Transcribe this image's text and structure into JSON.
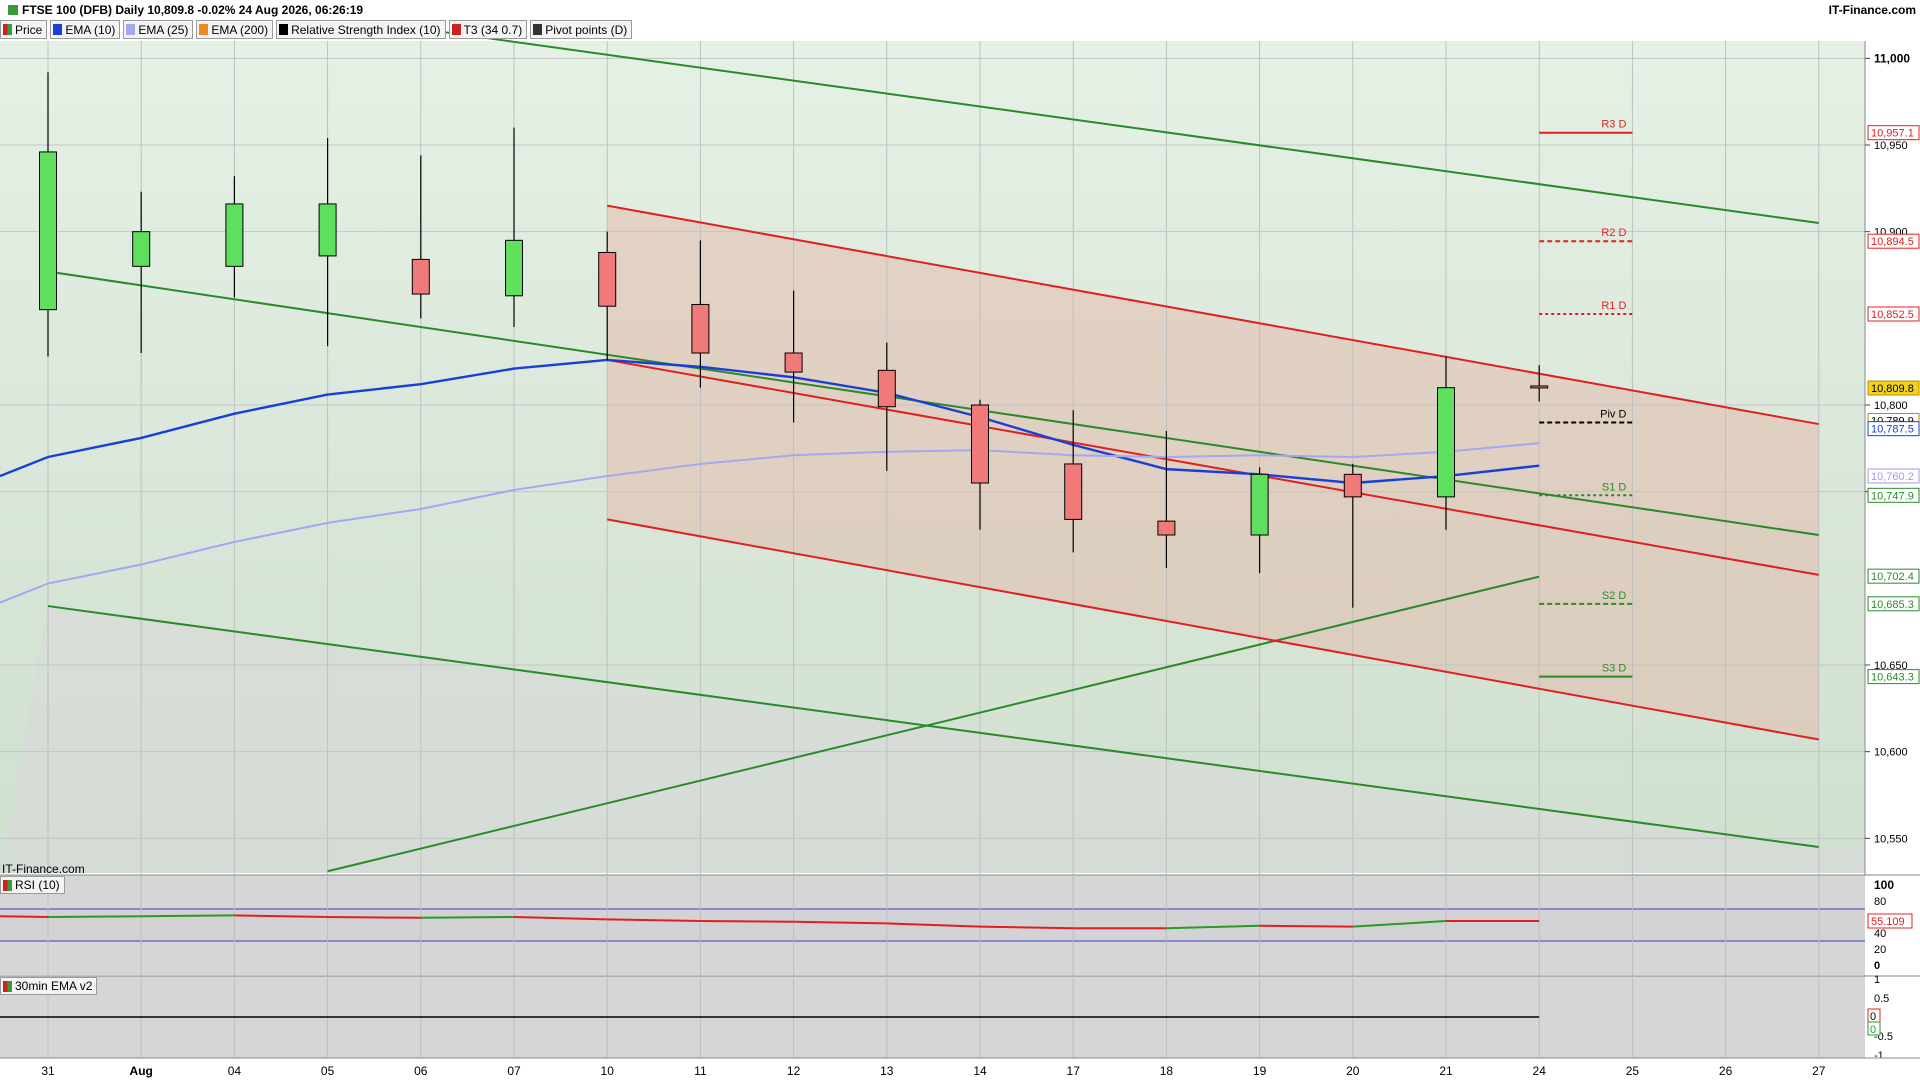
{
  "header": {
    "title": "FTSE 100 (DFB) Daily 10,809.8 -0.02% 24 Aug 2026, 06:26:19",
    "brand": "IT-Finance.com"
  },
  "legend": [
    {
      "label": "Price",
      "color": "#3a9a3a",
      "icon": "price-icon"
    },
    {
      "label": "EMA (10)",
      "color": "#1a3fd6",
      "icon": "swatch"
    },
    {
      "label": "EMA (25)",
      "color": "#a6a6f2",
      "icon": "swatch"
    },
    {
      "label": "EMA (200)",
      "color": "#f08a20",
      "icon": "swatch"
    },
    {
      "label": "Relative Strength Index (10)",
      "color": "#000000",
      "icon": "swatch"
    },
    {
      "label": "T3 (34 0.7)",
      "color": "#cc2222",
      "icon": "swatch"
    },
    {
      "label": "Pivot points (D)",
      "color": "#333333",
      "icon": "swatch"
    }
  ],
  "watermark": "IT-Finance.com",
  "rsi_pane": {
    "label": "RSI (10)",
    "value_label": "55.109",
    "levels": [
      "100",
      "80",
      "60",
      "40",
      "20",
      "0"
    ]
  },
  "ema_pane": {
    "label": "30min EMA v2",
    "levels": [
      "1",
      "0.5",
      "0",
      "-0.5",
      "-1"
    ],
    "value_labels": [
      "0",
      "0"
    ]
  },
  "chart_data": {
    "type": "candlestick",
    "x_labels": [
      "31",
      "Aug",
      "04",
      "05",
      "06",
      "07",
      "10",
      "11",
      "12",
      "13",
      "14",
      "17",
      "18",
      "19",
      "20",
      "21",
      "24",
      "25",
      "26",
      "27"
    ],
    "ylim": [
      10530,
      11010
    ],
    "y_ticks": [
      "11,000",
      "10,950",
      "10,900",
      "10,800",
      "10,750",
      "10,650",
      "10,600",
      "10,550"
    ],
    "candles": [
      {
        "date": "31",
        "open": 10855,
        "high": 10992,
        "low": 10828,
        "close": 10946
      },
      {
        "date": "Aug",
        "open": 10880,
        "high": 10923,
        "low": 10830,
        "close": 10900
      },
      {
        "date": "04",
        "open": 10880,
        "high": 10932,
        "low": 10862,
        "close": 10916
      },
      {
        "date": "05",
        "open": 10886,
        "high": 10954,
        "low": 10834,
        "close": 10916
      },
      {
        "date": "06",
        "open": 10884,
        "high": 10944,
        "low": 10850,
        "close": 10864
      },
      {
        "date": "07",
        "open": 10863,
        "high": 10960,
        "low": 10845,
        "close": 10895
      },
      {
        "date": "10",
        "open": 10888,
        "high": 10900,
        "low": 10826,
        "close": 10857
      },
      {
        "date": "11",
        "open": 10858,
        "high": 10895,
        "low": 10810,
        "close": 10830
      },
      {
        "date": "12",
        "open": 10830,
        "high": 10866,
        "low": 10790,
        "close": 10819
      },
      {
        "date": "13",
        "open": 10820,
        "high": 10836,
        "low": 10762,
        "close": 10799
      },
      {
        "date": "14",
        "open": 10800,
        "high": 10803,
        "low": 10728,
        "close": 10755
      },
      {
        "date": "17",
        "open": 10766,
        "high": 10797,
        "low": 10715,
        "close": 10734
      },
      {
        "date": "18",
        "open": 10733,
        "high": 10785,
        "low": 10706,
        "close": 10725
      },
      {
        "date": "19",
        "open": 10725,
        "high": 10764,
        "low": 10703,
        "close": 10760
      },
      {
        "date": "20",
        "open": 10760,
        "high": 10766,
        "low": 10683,
        "close": 10747
      },
      {
        "date": "21",
        "open": 10747,
        "high": 10828,
        "low": 10728,
        "close": 10810
      },
      {
        "date": "24",
        "open": 10811,
        "high": 10823,
        "low": 10802,
        "close": 10810
      }
    ],
    "series": [
      {
        "name": "EMA (10)",
        "color": "#1a3fd6",
        "values": [
          10770,
          10781,
          10795,
          10806,
          10812,
          10821,
          10826,
          10822,
          10816,
          10807,
          10793,
          10777,
          10763,
          10760,
          10755,
          10759,
          10765
        ]
      },
      {
        "name": "EMA (25)",
        "color": "#a6a6f2",
        "values": [
          10697,
          10708,
          10721,
          10732,
          10740,
          10751,
          10759,
          10766,
          10771,
          10773,
          10774,
          10771,
          10770,
          10771,
          10770,
          10773,
          10778
        ]
      }
    ],
    "trendlines": [
      {
        "color": "#2a8a2a",
        "from": [
          "31",
          10877
        ],
        "to": [
          "27",
          10725
        ]
      },
      {
        "color": "#2a8a2a",
        "from": [
          "06",
          11017
        ],
        "to": [
          "27",
          10905
        ]
      },
      {
        "color": "#2a8a2a",
        "from": [
          "31",
          10684
        ],
        "to": [
          "27",
          10545
        ]
      },
      {
        "color": "#2a8a2a",
        "from": [
          "05",
          10531
        ],
        "to": [
          "24",
          10701
        ]
      },
      {
        "color": "#e02020",
        "from": [
          "10",
          10915
        ],
        "to": [
          "27",
          10789
        ]
      },
      {
        "color": "#e02020",
        "from": [
          "10",
          10826
        ],
        "to": [
          "27",
          10702
        ]
      },
      {
        "color": "#e02020",
        "from": [
          "10",
          10734
        ],
        "to": [
          "27",
          10607
        ]
      }
    ],
    "pivots": [
      {
        "label": "R3 D",
        "value": 10957.1,
        "value_label": "10,957.1",
        "color": "#e02020",
        "style": "solid"
      },
      {
        "label": "R2 D",
        "value": 10894.5,
        "value_label": "10,894.5",
        "color": "#e02020",
        "style": "dashed"
      },
      {
        "label": "R1 D",
        "value": 10852.5,
        "value_label": "10,852.5",
        "color": "#e02020",
        "style": "dotted"
      },
      {
        "label": "Piv D",
        "value": 10789.9,
        "value_label": "10,789.9",
        "color": "#000000",
        "style": "dashed"
      },
      {
        "label": "S1 D",
        "value": 10747.9,
        "value_label": "10,747.9",
        "color": "#2a8a2a",
        "style": "dotted"
      },
      {
        "label": "S2 D",
        "value": 10685.3,
        "value_label": "10,685.3",
        "color": "#2a8a2a",
        "style": "dashed"
      },
      {
        "label": "S3 D",
        "value": 10643.3,
        "value_label": "10,643.3",
        "color": "#2a8a2a",
        "style": "solid"
      }
    ],
    "price_labels": [
      {
        "value": 10809.8,
        "text": "10,809.8",
        "bg": "#f3d21d",
        "fg": "#000000"
      },
      {
        "value": 10787.5,
        "text": "10,787.5",
        "bg": "#ffffff",
        "fg": "#1a3fd6"
      },
      {
        "value": 10760.2,
        "text": "10,760.2",
        "bg": "#ffffff",
        "fg": "#9a9ae8"
      },
      {
        "value": 10702.4,
        "text": "10,702.4",
        "bg": "#ffffff",
        "fg": "#2a8a2a"
      }
    ],
    "rsi": {
      "ylim": [
        0,
        100
      ],
      "upper": 70,
      "lower": 30,
      "values": [
        60,
        61,
        62,
        60,
        59,
        60,
        57,
        55,
        54,
        52,
        48,
        46,
        46,
        49,
        48,
        55,
        55
      ]
    }
  }
}
